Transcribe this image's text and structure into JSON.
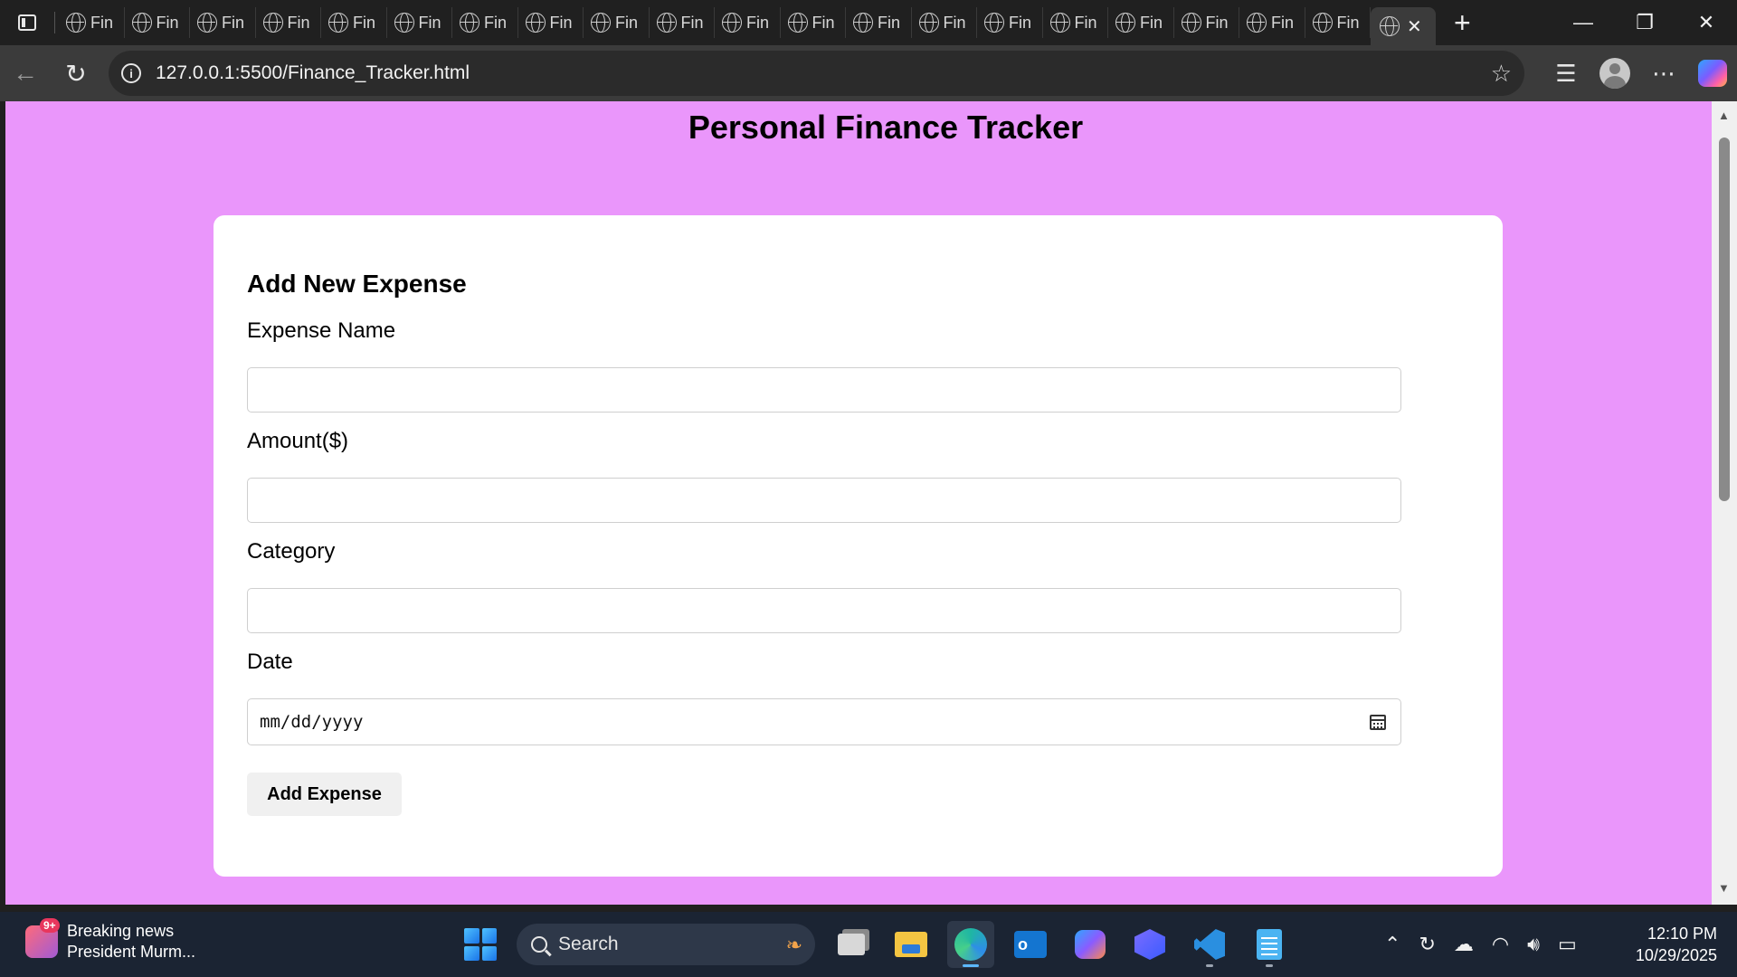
{
  "browser": {
    "tab_title_truncated": "Fin",
    "tab_count_visible": 20,
    "active_tab_close": "✕",
    "new_tab": "+",
    "url": "127.0.0.1:5500/Finance_Tracker.html",
    "window_controls": {
      "minimize": "—",
      "restore": "❐",
      "close": "✕"
    }
  },
  "page": {
    "background_color": "#ea96fb",
    "title": "Personal Finance Tracker",
    "form": {
      "heading": "Add New Expense",
      "fields": [
        {
          "label": "Expense Name",
          "value": "",
          "placeholder": ""
        },
        {
          "label": "Amount($)",
          "value": "",
          "placeholder": ""
        },
        {
          "label": "Category",
          "value": "",
          "placeholder": ""
        }
      ],
      "date_label": "Date",
      "date_placeholder": "mm/dd/yyyy",
      "submit_label": "Add Expense"
    }
  },
  "taskbar": {
    "news_badge": "9+",
    "news_title": "Breaking news",
    "news_subtitle": "President Murm...",
    "search_label": "Search",
    "time": "12:10 PM",
    "date": "10/29/2025"
  }
}
